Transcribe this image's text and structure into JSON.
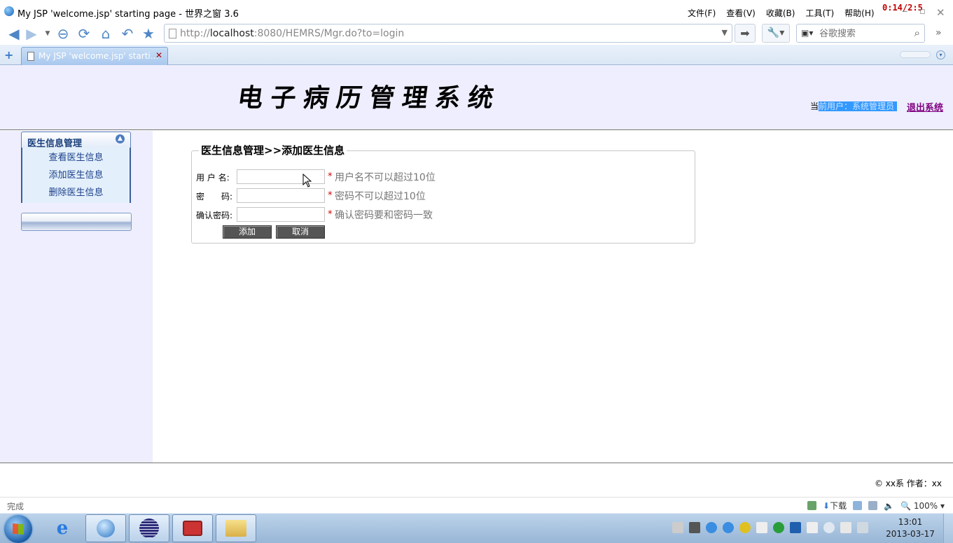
{
  "browser": {
    "window_title": "My JSP 'welcome.jsp' starting page - 世界之窗 3.6",
    "menu": [
      "文件(F)",
      "查看(V)",
      "收藏(B)",
      "工具(T)",
      "帮助(H)"
    ],
    "timer": "0:14/2:5",
    "url_prefix": "http://",
    "url_host": "localhost",
    "url_rest": ":8080/HEMRS/Mgr.do?to=login",
    "search_placeholder": "谷歌搜索",
    "tab_label": "My JSP 'welcome.jsp' starti...",
    "status": "完成",
    "download_label": "下载",
    "zoom": "100%"
  },
  "header": {
    "system_title": "电子病历管理系统",
    "user_prefix": "当",
    "user_text": "前用户：系统管理员",
    "logout": "退出系统"
  },
  "sidebar": {
    "section_title": "医生信息管理",
    "items": [
      {
        "label": "查看医生信息"
      },
      {
        "label": "添加医生信息"
      },
      {
        "label": "删除医生信息"
      }
    ]
  },
  "form": {
    "legend": "医生信息管理>>添加医生信息",
    "fields": [
      {
        "label": "用 户 名:",
        "value": "",
        "hint": "用户名不可以超过10位"
      },
      {
        "label": "密　　码:",
        "value": "",
        "hint": "密码不可以超过10位"
      },
      {
        "label": "确认密码:",
        "value": "",
        "hint": "确认密码要和密码一致"
      }
    ],
    "required_mark": "*",
    "add_label": "添加",
    "cancel_label": "取消"
  },
  "footer": {
    "copyright": "© xx系 作者：xx"
  },
  "taskbar": {
    "time": "13:01",
    "date": "2013-03-17"
  },
  "colors": {
    "header_bg": "#eeeefe",
    "accent_link": "#800080",
    "required": "#d40000",
    "button_bg": "#555555"
  }
}
